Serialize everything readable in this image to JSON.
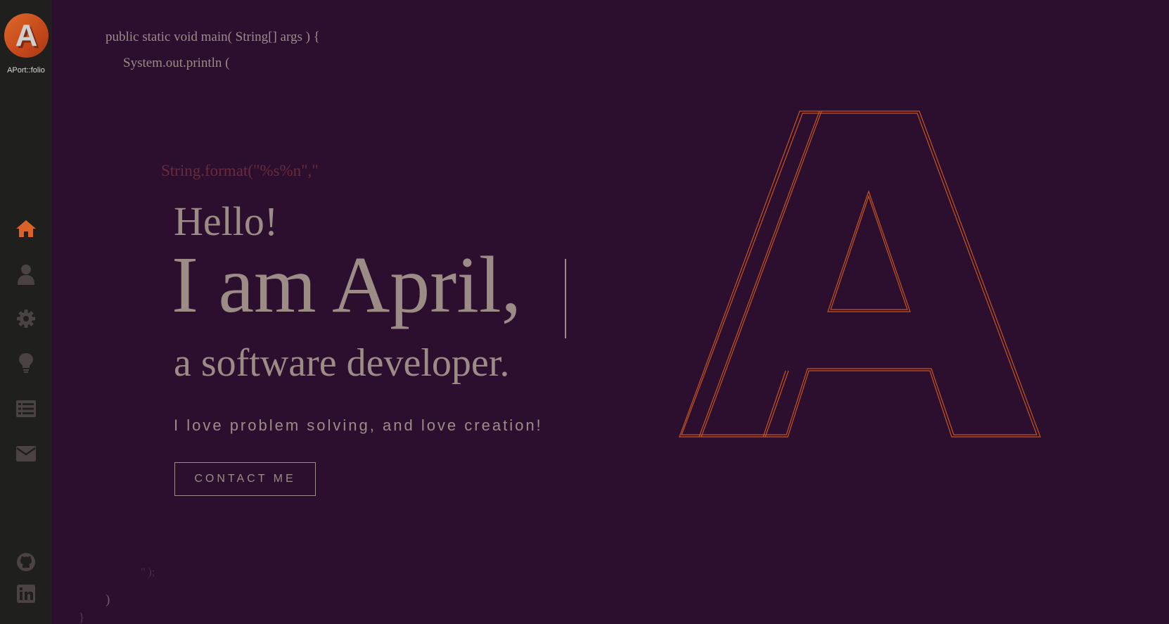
{
  "brand": {
    "logo_letter": "A",
    "name": "APort::folio",
    "accent_color": "#d9622b"
  },
  "sidebar": {
    "nav": [
      {
        "icon": "home-icon",
        "active": true
      },
      {
        "icon": "user-icon",
        "active": false
      },
      {
        "icon": "gear-icon",
        "active": false
      },
      {
        "icon": "lightbulb-icon",
        "active": false
      },
      {
        "icon": "list-icon",
        "active": false
      },
      {
        "icon": "envelope-icon",
        "active": false
      }
    ],
    "social": [
      {
        "icon": "github-icon"
      },
      {
        "icon": "linkedin-icon"
      }
    ]
  },
  "background_code": {
    "line1": "public static void main( String[] args ) {",
    "line2": "System.out.println (",
    "format": "String.format(\"%s%n\",\"",
    "close1": "\" );",
    "close2": ")",
    "close3": "}"
  },
  "hero": {
    "greeting": "Hello!",
    "intro": "I am April,",
    "role": "a software developer.",
    "tagline": "I love problem solving, and love creation!",
    "cta_label": "CONTACT ME"
  },
  "decor": {
    "big_letter": "A",
    "outline_color": "#c4551f"
  }
}
